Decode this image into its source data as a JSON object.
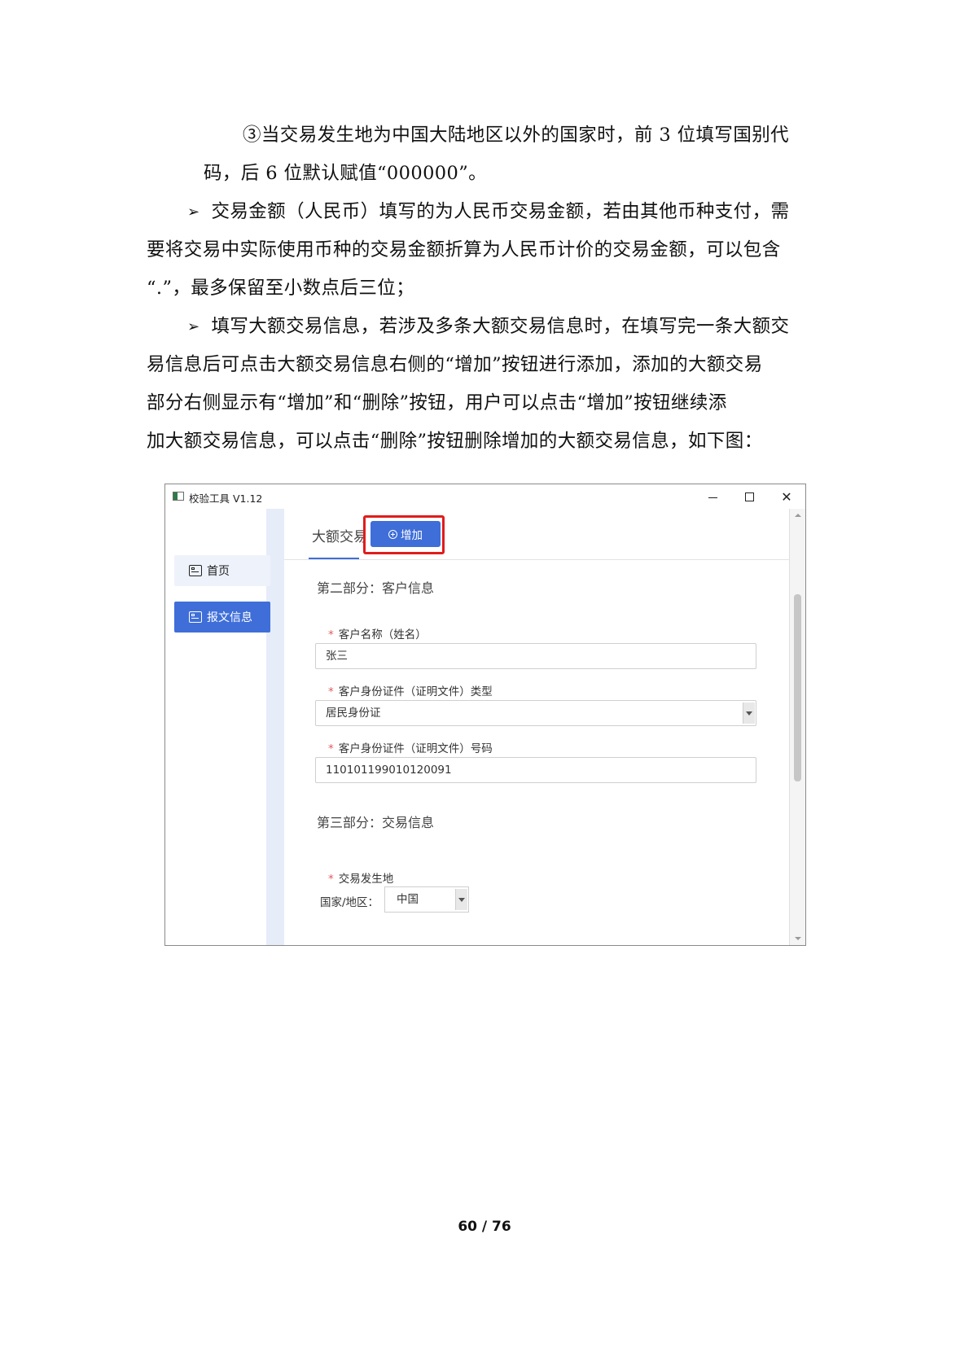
{
  "document": {
    "lines": [
      "③当交易发生地为中国大陆地区以外的国家时，前 3 位填写国别代",
      "码，后 6 位默认赋值“000000”。",
      "交易金额（人民币）填写的为人民币交易金额，若由其他币种支付，需",
      "要将交易中实际使用币种的交易金额折算为人民币计价的交易金额，可以包含",
      "“.”，最多保留至小数点后三位；",
      "填写大额交易信息，若涉及多条大额交易信息时，在填写完一条大额交",
      "易信息后可点击大额交易信息右侧的“增加”按钮进行添加，添加的大额交易",
      "部分右侧显示有“增加”和“删除”按钮，用户可以点击“增加”按钮继续添",
      "加大额交易信息，可以点击“删除”按钮删除增加的大额交易信息，如下图："
    ],
    "bullet_symbol": "➢",
    "page_number": "60 / 76"
  },
  "window": {
    "title": "校验工具 V1.12",
    "controls": {
      "minimize": "minimize",
      "maximize": "maximize",
      "close": "✕"
    }
  },
  "sidebar": {
    "items": [
      {
        "label": "首页",
        "icon": "form-icon"
      },
      {
        "label": "报文信息",
        "icon": "form-icon",
        "active": true
      }
    ]
  },
  "main": {
    "tab_label": "大额交易",
    "add_button_label": "增加",
    "section2_title": "第二部分：客户信息",
    "fields": [
      {
        "label": "客户名称（姓名）",
        "value": "张三",
        "required_mark": "*"
      },
      {
        "label": "客户身份证件（证明文件）类型",
        "value": "居民身份证",
        "required_mark": "*"
      },
      {
        "label": "客户身份证件（证明文件）号码",
        "value": "110101199010120091",
        "required_mark": "*"
      }
    ],
    "section3_title": "第三部分：交易信息",
    "location_label": "交易发生地",
    "location_required_mark": "*",
    "country_label": "国家/地区：",
    "country_value": "中国"
  },
  "colors": {
    "accent": "#3f6ed8",
    "highlight": "#e01c1c",
    "rail": "#e6ecf8"
  }
}
